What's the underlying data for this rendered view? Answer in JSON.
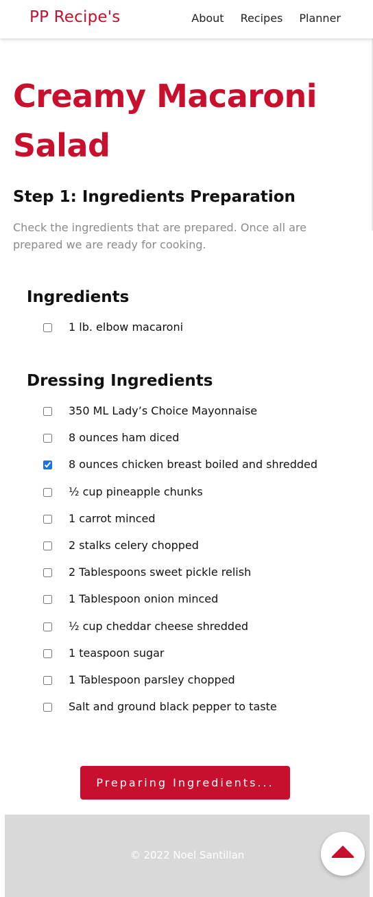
{
  "nav": {
    "brand": "PP Recipe's",
    "links": [
      "About",
      "Recipes",
      "Planner"
    ]
  },
  "recipe": {
    "title": "Creamy Macaroni Salad",
    "step_title": "Step 1: Ingredients Preparation",
    "step_description": "Check the ingredients that are prepared. Once all are prepared we are ready for cooking."
  },
  "ingredients": {
    "title": "Ingredients",
    "items": [
      {
        "label": "1 lb. elbow macaroni",
        "checked": false
      }
    ]
  },
  "dressing": {
    "title": "Dressing Ingredients",
    "items": [
      {
        "label": "350 ML Lady’s Choice Mayonnaise",
        "checked": false
      },
      {
        "label": "8 ounces ham diced",
        "checked": false
      },
      {
        "label": "8 ounces chicken breast boiled and shredded",
        "checked": true
      },
      {
        "label": "½ cup pineapple chunks",
        "checked": false
      },
      {
        "label": "1 carrot minced",
        "checked": false
      },
      {
        "label": "2 stalks celery chopped",
        "checked": false
      },
      {
        "label": "2 Tablespoons sweet pickle relish",
        "checked": false
      },
      {
        "label": "1 Tablespoon onion minced",
        "checked": false
      },
      {
        "label": "½ cup cheddar cheese shredded",
        "checked": false
      },
      {
        "label": "1 teaspoon sugar",
        "checked": false
      },
      {
        "label": "1 Tablespoon parsley chopped",
        "checked": false
      },
      {
        "label": "Salt and ground black pepper to taste",
        "checked": false
      }
    ]
  },
  "button": {
    "label": "Preparing Ingredients..."
  },
  "footer": {
    "text": "© 2022 Noel Santillan"
  },
  "scroll_top": {
    "icon": "caret-up-icon"
  },
  "colors": {
    "brand": "#c8102e",
    "footer_bg": "#d9d9d9"
  }
}
